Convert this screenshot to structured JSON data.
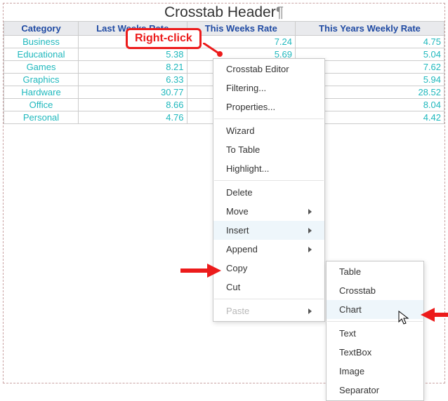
{
  "header": {
    "title": "Crosstab Header",
    "pilcrow": "¶"
  },
  "columns": [
    "Category",
    "Last Weeks Rate",
    "This Weeks Rate",
    "This Years Weekly Rate"
  ],
  "rows": [
    {
      "cat": "Business",
      "last": "",
      "this": "7.24",
      "year": "4.75"
    },
    {
      "cat": "Educational",
      "last": "5.38",
      "this": "5.69",
      "year": "5.04"
    },
    {
      "cat": "Games",
      "last": "8.21",
      "this": "",
      "year": "7.62"
    },
    {
      "cat": "Graphics",
      "last": "6.33",
      "this": "",
      "year": "5.94"
    },
    {
      "cat": "Hardware",
      "last": "30.77",
      "this": "",
      "year": "28.52"
    },
    {
      "cat": "Office",
      "last": "8.66",
      "this": "",
      "year": "8.04"
    },
    {
      "cat": "Personal",
      "last": "4.76",
      "this": "",
      "year": "4.42"
    }
  ],
  "callout": {
    "label": "Right-click"
  },
  "menu": {
    "items": [
      "Crosstab Editor",
      "Filtering...",
      "Properties...",
      "---",
      "Wizard",
      "To Table",
      "Highlight...",
      "---",
      "Delete",
      "Move",
      "Insert",
      "Append",
      "Copy",
      "Cut",
      "---",
      "Paste"
    ],
    "submenu_of": "Insert",
    "subflags": {
      "Move": true,
      "Insert": true,
      "Append": true,
      "Paste": true
    },
    "disabled": {
      "Paste": true
    }
  },
  "submenu": {
    "items": [
      "Table",
      "Crosstab",
      "Chart",
      "---",
      "Text",
      "TextBox",
      "Image",
      "Separator"
    ],
    "hover": "Chart"
  }
}
